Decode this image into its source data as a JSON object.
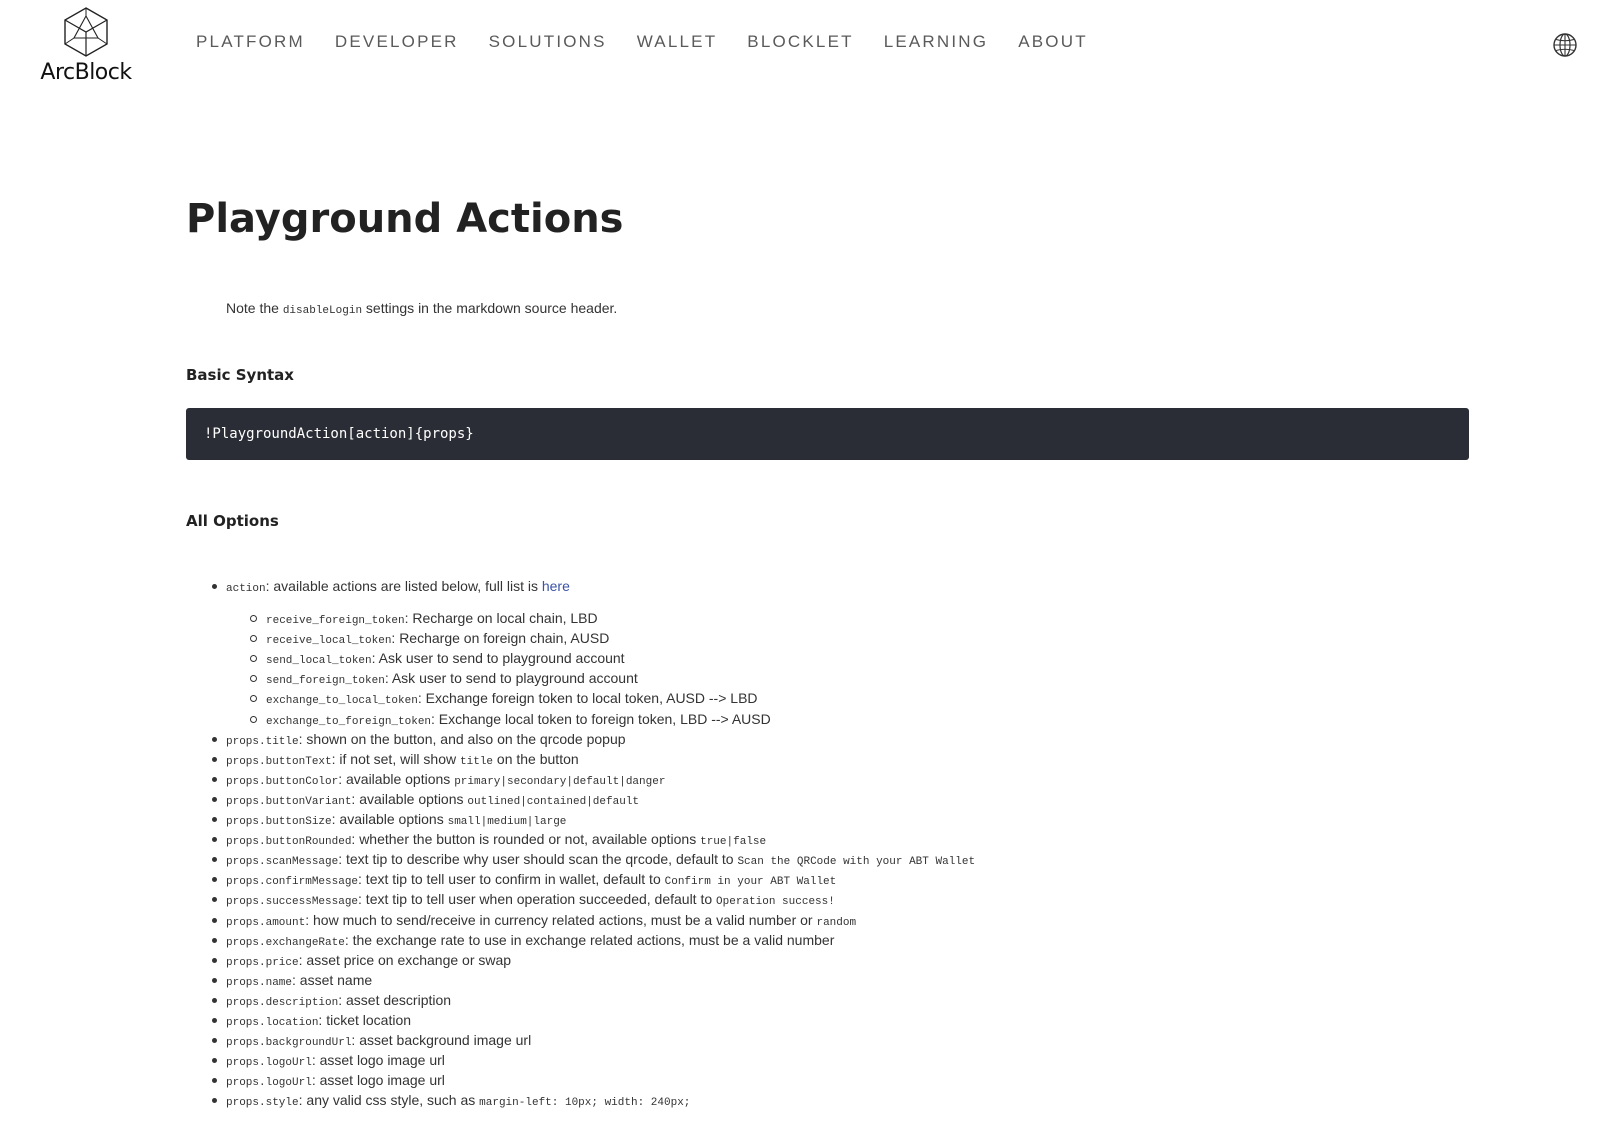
{
  "brand": {
    "name": "ArcBlock",
    "logo_icon": "hexagon-cube-logo-icon"
  },
  "nav": {
    "items": [
      "PLATFORM",
      "DEVELOPER",
      "SOLUTIONS",
      "WALLET",
      "BLOCKLET",
      "LEARNING",
      "ABOUT"
    ],
    "language_icon": "globe-icon"
  },
  "page": {
    "title": "Playground Actions",
    "note": {
      "prefix": "Note the ",
      "code": "disableLogin",
      "suffix": " settings in the markdown source header."
    },
    "basic_syntax": {
      "heading": "Basic Syntax",
      "code": "!PlaygroundAction[action]{props}"
    },
    "all_options": {
      "heading": "All Options"
    }
  },
  "options": {
    "action": {
      "code": "action",
      "text": ": available actions are listed below, full list is ",
      "link": "here"
    },
    "actions": [
      {
        "code": "receive_foreign_token",
        "text": ": Recharge on local chain, LBD"
      },
      {
        "code": "receive_local_token",
        "text": ": Recharge on foreign chain, AUSD"
      },
      {
        "code": "send_local_token",
        "text": ": Ask user to send to playground account"
      },
      {
        "code": "send_foreign_token",
        "text": ": Ask user to send to playground account"
      },
      {
        "code": "exchange_to_local_token",
        "text": ": Exchange foreign token to local token, AUSD --> LBD"
      },
      {
        "code": "exchange_to_foreign_token",
        "text": ": Exchange local token to foreign token, LBD --> AUSD"
      }
    ],
    "props": [
      {
        "code": "props.title",
        "text": ": shown on the button, and also on the qrcode popup",
        "code2": "",
        "text2": ""
      },
      {
        "code": "props.buttonText",
        "text": ": if not set, will show ",
        "code2": "title",
        "text2": " on the button"
      },
      {
        "code": "props.buttonColor",
        "text": ": available options ",
        "code2": "primary|secondary|default|danger",
        "text2": ""
      },
      {
        "code": "props.buttonVariant",
        "text": ": available options ",
        "code2": "outlined|contained|default",
        "text2": ""
      },
      {
        "code": "props.buttonSize",
        "text": ": available options ",
        "code2": "small|medium|large",
        "text2": ""
      },
      {
        "code": "props.buttonRounded",
        "text": ": whether the button is rounded or not, available options ",
        "code2": "true|false",
        "text2": ""
      },
      {
        "code": "props.scanMessage",
        "text": ": text tip to describe why user should scan the qrcode, default to ",
        "code2": "Scan the QRCode with your ABT Wallet",
        "text2": ""
      },
      {
        "code": "props.confirmMessage",
        "text": ": text tip to tell user to confirm in wallet, default to ",
        "code2": "Confirm in your ABT Wallet",
        "text2": ""
      },
      {
        "code": "props.successMessage",
        "text": ": text tip to tell user when operation succeeded, default to ",
        "code2": "Operation success!",
        "text2": ""
      },
      {
        "code": "props.amount",
        "text": ": how much to send/receive in currency related actions, must be a valid number or ",
        "code2": "random",
        "text2": ""
      },
      {
        "code": "props.exchangeRate",
        "text": ": the exchange rate to use in exchange related actions, must be a valid number",
        "code2": "",
        "text2": ""
      },
      {
        "code": "props.price",
        "text": ": asset price on exchange or swap",
        "code2": "",
        "text2": ""
      },
      {
        "code": "props.name",
        "text": ": asset name",
        "code2": "",
        "text2": ""
      },
      {
        "code": "props.description",
        "text": ": asset description",
        "code2": "",
        "text2": ""
      },
      {
        "code": "props.location",
        "text": ": ticket location",
        "code2": "",
        "text2": ""
      },
      {
        "code": "props.backgroundUrl",
        "text": ": asset background image url",
        "code2": "",
        "text2": ""
      },
      {
        "code": "props.logoUrl",
        "text": ": asset logo image url",
        "code2": "",
        "text2": ""
      },
      {
        "code": "props.logoUrl",
        "text": ": asset logo image url",
        "code2": "",
        "text2": ""
      },
      {
        "code": "props.style",
        "text": ": any valid css style, such as ",
        "code2": "margin-left: 10px; width: 240px;",
        "text2": ""
      }
    ]
  }
}
